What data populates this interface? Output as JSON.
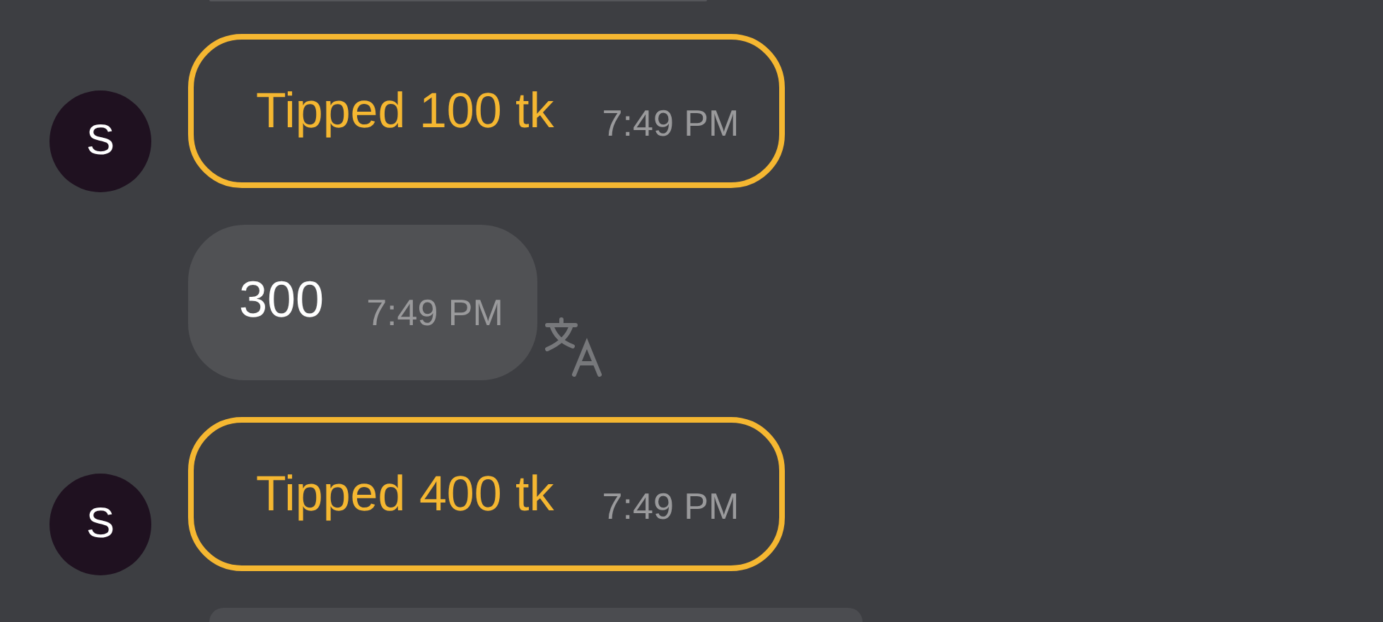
{
  "messages": [
    {
      "kind": "tip",
      "avatar": "S",
      "text": "Tipped 100 tk",
      "time": "7:49 PM"
    },
    {
      "kind": "text",
      "text": "300",
      "time": "7:49 PM",
      "translatable": true
    },
    {
      "kind": "tip",
      "avatar": "S",
      "text": "Tipped 400 tk",
      "time": "7:49 PM"
    }
  ]
}
